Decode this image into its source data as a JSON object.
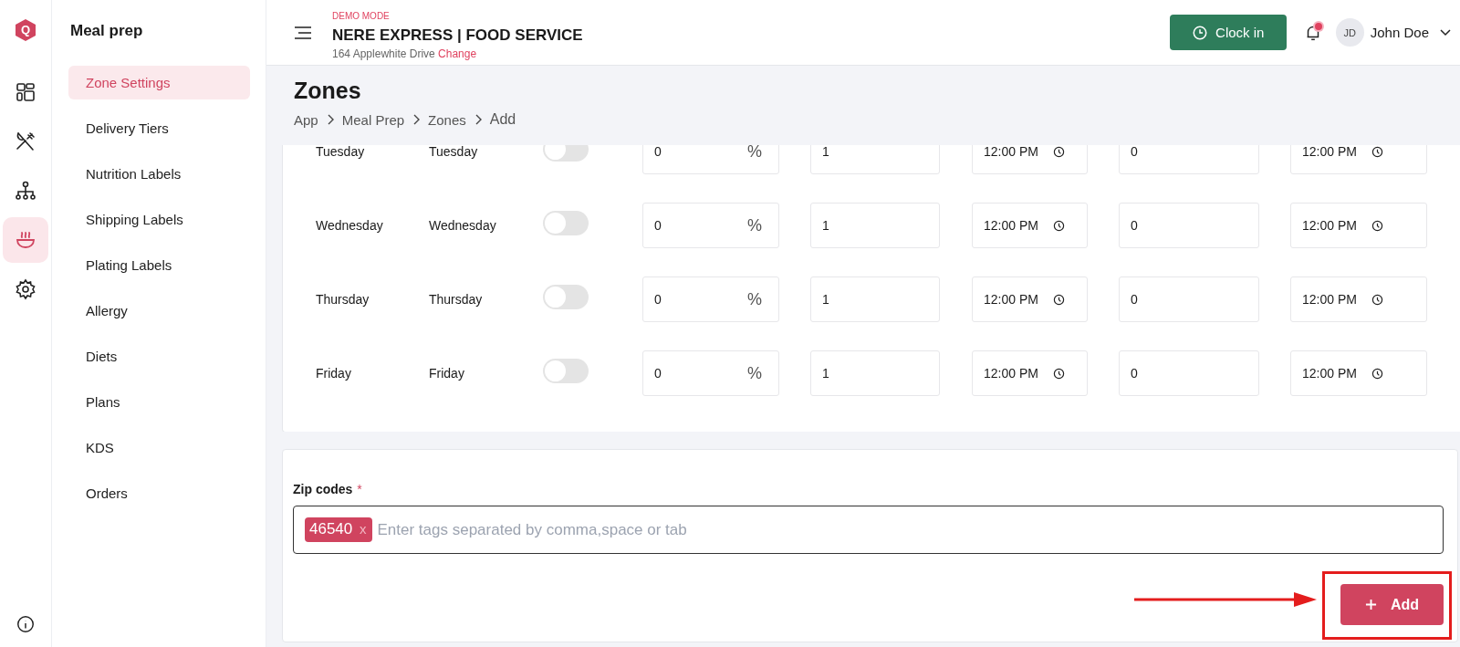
{
  "rail": {
    "logo_letter": "Q",
    "items": [
      {
        "kind": "dashboard",
        "selected": false
      },
      {
        "kind": "utensils",
        "selected": false
      },
      {
        "kind": "hierarchy",
        "selected": false
      },
      {
        "kind": "bowl",
        "selected": true
      },
      {
        "kind": "settings",
        "selected": false
      }
    ]
  },
  "sidebar": {
    "title": "Meal prep",
    "items": [
      {
        "label": "Zone Settings",
        "selected": true
      },
      {
        "label": "Delivery Tiers",
        "selected": false
      },
      {
        "label": "Nutrition Labels",
        "selected": false
      },
      {
        "label": "Shipping Labels",
        "selected": false
      },
      {
        "label": "Plating Labels",
        "selected": false
      },
      {
        "label": "Allergy",
        "selected": false
      },
      {
        "label": "Diets",
        "selected": false
      },
      {
        "label": "Plans",
        "selected": false
      },
      {
        "label": "KDS",
        "selected": false
      },
      {
        "label": "Orders",
        "selected": false
      }
    ]
  },
  "header": {
    "mode": "DEMO MODE",
    "store": "NERE EXPRESS | FOOD SERVICE",
    "address": "164 Applewhite Drive",
    "change_link": "Change",
    "clock_button": "Clock in",
    "notification": true,
    "avatar_initials": "JD",
    "user_name": "John Doe"
  },
  "page": {
    "title": "Zones",
    "breadcrumb": [
      "App",
      "Meal Prep",
      "Zones",
      "Add"
    ]
  },
  "schedule_rows": [
    {
      "day": "Tuesday",
      "label": "Tuesday",
      "on": false,
      "percent": "0",
      "percent_sign": "%",
      "field_2": "1",
      "time_1": "12:00 PM",
      "field_4": "0",
      "time_2": "12:00 PM"
    },
    {
      "day": "Wednesday",
      "label": "Wednesday",
      "on": false,
      "percent": "0",
      "percent_sign": "%",
      "field_2": "1",
      "time_1": "12:00 PM",
      "field_4": "0",
      "time_2": "12:00 PM"
    },
    {
      "day": "Thursday",
      "label": "Thursday",
      "on": false,
      "percent": "0",
      "percent_sign": "%",
      "field_2": "1",
      "time_1": "12:00 PM",
      "field_4": "0",
      "time_2": "12:00 PM"
    },
    {
      "day": "Friday",
      "label": "Friday",
      "on": false,
      "percent": "0",
      "percent_sign": "%",
      "field_2": "1",
      "time_1": "12:00 PM",
      "field_4": "0",
      "time_2": "12:00 PM"
    }
  ],
  "zip_codes": {
    "label": "Zip codes",
    "required_mark": "*",
    "tags": [
      {
        "text": "46540",
        "remove": "x"
      }
    ],
    "placeholder": "Enter tags separated by comma,space or tab"
  },
  "add_button": "Add",
  "annotation": {
    "highlight": true
  }
}
